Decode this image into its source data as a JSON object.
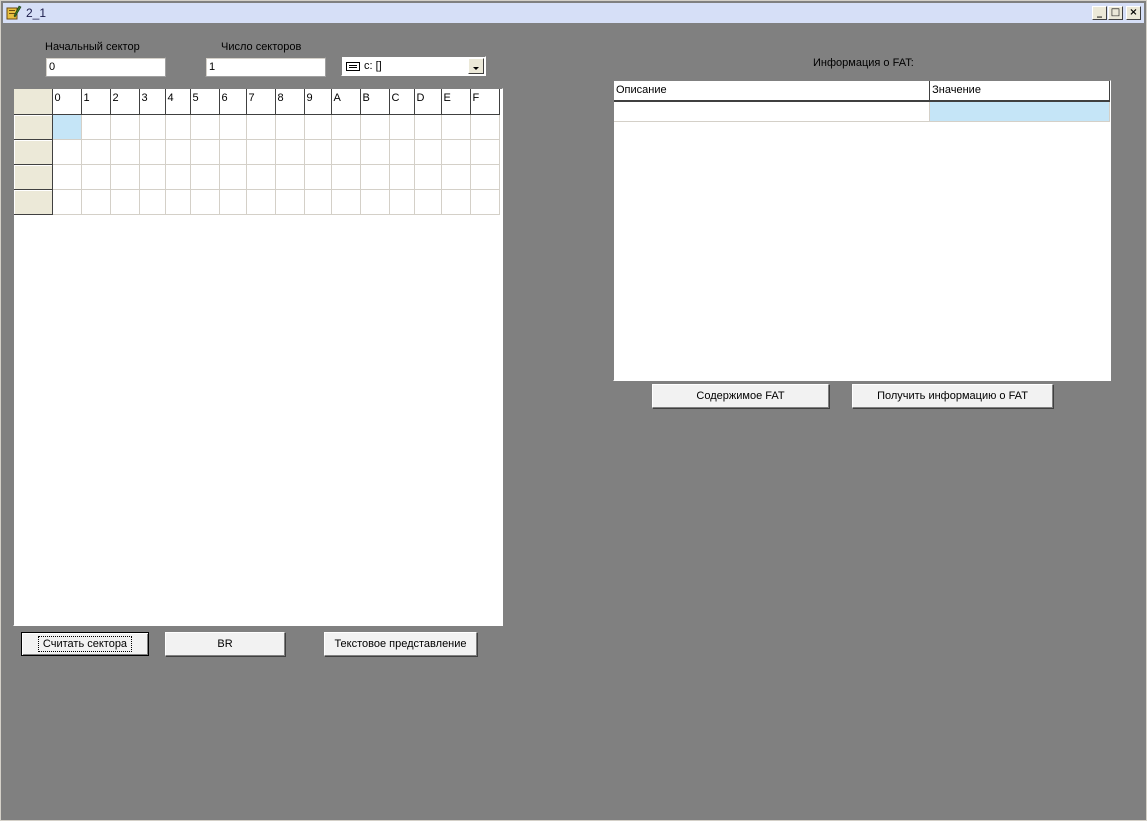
{
  "window": {
    "title": "2_1",
    "minimize_glyph": "_",
    "maximize_glyph": "□",
    "close_glyph": "×"
  },
  "controls": {
    "start_sector_label": "Начальный сектор",
    "start_sector_value": "0",
    "sector_count_label": "Число секторов",
    "sector_count_value": "1",
    "drive_selected": "c: []"
  },
  "hex_grid": {
    "columns": [
      "0",
      "1",
      "2",
      "3",
      "4",
      "5",
      "6",
      "7",
      "8",
      "9",
      "A",
      "B",
      "C",
      "D",
      "E",
      "F"
    ],
    "rows": 4,
    "selected_cell": {
      "row": 0,
      "col": 0
    }
  },
  "buttons": {
    "read_sectors": "Считать сектора",
    "br": "BR",
    "text_view": "Текстовое представление",
    "fat_contents": "Содержимое FAT",
    "get_fat_info": "Получить информацию о FAT"
  },
  "fat_info": {
    "title": "Информация о FAT:",
    "columns": [
      "Описание",
      "Значение"
    ],
    "rows": [
      [
        "",
        ""
      ]
    ]
  },
  "colors": {
    "background": "#808080",
    "titlebar": "#d6dff7",
    "selection": "#c5e5f7"
  }
}
